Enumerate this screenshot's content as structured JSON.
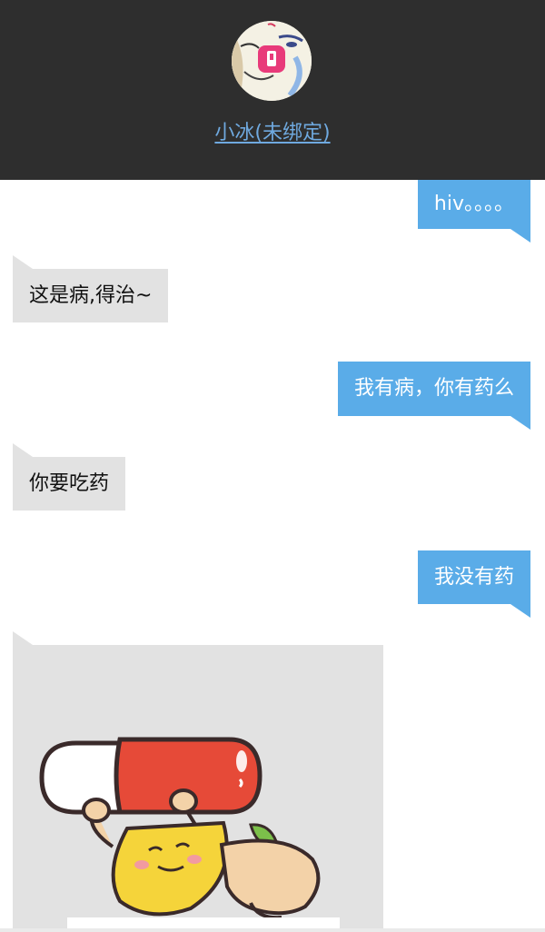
{
  "header": {
    "contact_name": "小冰(未绑定)",
    "avatar_icon": "xiaoice-avatar-icon"
  },
  "messages": [
    {
      "side": "right",
      "text": "hiv。。。。"
    },
    {
      "side": "left",
      "text": "这是病,得治~"
    },
    {
      "side": "right",
      "text": "我有病，你有药么"
    },
    {
      "side": "left",
      "text": "你要吃药"
    },
    {
      "side": "right",
      "text": "我没有药"
    }
  ],
  "sticker": {
    "icon": "pill-carrying-character-sticker"
  },
  "colors": {
    "header_bg": "#2e2e2e",
    "name_link": "#6fa9df",
    "outgoing_bubble": "#5aace8",
    "incoming_bubble": "#e2e2e2"
  }
}
